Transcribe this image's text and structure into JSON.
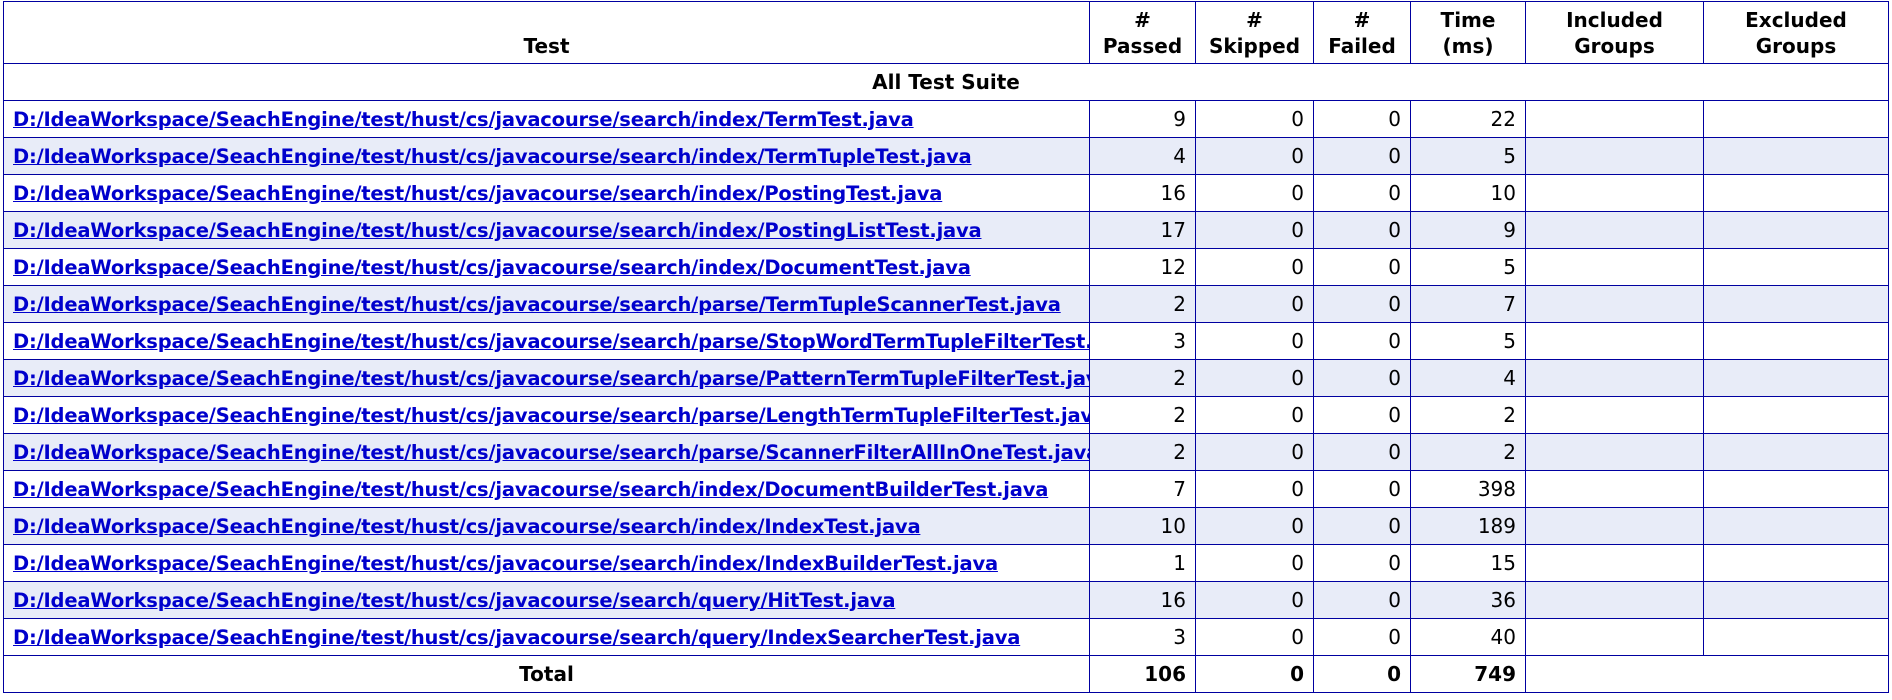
{
  "headers": {
    "test": "Test",
    "passed": "# Passed",
    "skipped": "# Skipped",
    "failed": "# Failed",
    "time": "Time (ms)",
    "included": "Included Groups",
    "excluded": "Excluded Groups"
  },
  "suite_title": "All Test Suite",
  "rows": [
    {
      "name": "D:/IdeaWorkspace/SeachEngine/test/hust/cs/javacourse/search/index/TermTest.java",
      "passed": "9",
      "skipped": "0",
      "failed": "0",
      "time": "22",
      "included": "",
      "excluded": ""
    },
    {
      "name": "D:/IdeaWorkspace/SeachEngine/test/hust/cs/javacourse/search/index/TermTupleTest.java",
      "passed": "4",
      "skipped": "0",
      "failed": "0",
      "time": "5",
      "included": "",
      "excluded": ""
    },
    {
      "name": "D:/IdeaWorkspace/SeachEngine/test/hust/cs/javacourse/search/index/PostingTest.java",
      "passed": "16",
      "skipped": "0",
      "failed": "0",
      "time": "10",
      "included": "",
      "excluded": ""
    },
    {
      "name": "D:/IdeaWorkspace/SeachEngine/test/hust/cs/javacourse/search/index/PostingListTest.java",
      "passed": "17",
      "skipped": "0",
      "failed": "0",
      "time": "9",
      "included": "",
      "excluded": ""
    },
    {
      "name": "D:/IdeaWorkspace/SeachEngine/test/hust/cs/javacourse/search/index/DocumentTest.java",
      "passed": "12",
      "skipped": "0",
      "failed": "0",
      "time": "5",
      "included": "",
      "excluded": ""
    },
    {
      "name": "D:/IdeaWorkspace/SeachEngine/test/hust/cs/javacourse/search/parse/TermTupleScannerTest.java",
      "passed": "2",
      "skipped": "0",
      "failed": "0",
      "time": "7",
      "included": "",
      "excluded": ""
    },
    {
      "name": "D:/IdeaWorkspace/SeachEngine/test/hust/cs/javacourse/search/parse/StopWordTermTupleFilterTest.java",
      "passed": "3",
      "skipped": "0",
      "failed": "0",
      "time": "5",
      "included": "",
      "excluded": ""
    },
    {
      "name": "D:/IdeaWorkspace/SeachEngine/test/hust/cs/javacourse/search/parse/PatternTermTupleFilterTest.java",
      "passed": "2",
      "skipped": "0",
      "failed": "0",
      "time": "4",
      "included": "",
      "excluded": ""
    },
    {
      "name": "D:/IdeaWorkspace/SeachEngine/test/hust/cs/javacourse/search/parse/LengthTermTupleFilterTest.java",
      "passed": "2",
      "skipped": "0",
      "failed": "0",
      "time": "2",
      "included": "",
      "excluded": ""
    },
    {
      "name": "D:/IdeaWorkspace/SeachEngine/test/hust/cs/javacourse/search/parse/ScannerFilterAllInOneTest.java",
      "passed": "2",
      "skipped": "0",
      "failed": "0",
      "time": "2",
      "included": "",
      "excluded": ""
    },
    {
      "name": "D:/IdeaWorkspace/SeachEngine/test/hust/cs/javacourse/search/index/DocumentBuilderTest.java",
      "passed": "7",
      "skipped": "0",
      "failed": "0",
      "time": "398",
      "included": "",
      "excluded": ""
    },
    {
      "name": "D:/IdeaWorkspace/SeachEngine/test/hust/cs/javacourse/search/index/IndexTest.java",
      "passed": "10",
      "skipped": "0",
      "failed": "0",
      "time": "189",
      "included": "",
      "excluded": ""
    },
    {
      "name": "D:/IdeaWorkspace/SeachEngine/test/hust/cs/javacourse/search/index/IndexBuilderTest.java",
      "passed": "1",
      "skipped": "0",
      "failed": "0",
      "time": "15",
      "included": "",
      "excluded": ""
    },
    {
      "name": "D:/IdeaWorkspace/SeachEngine/test/hust/cs/javacourse/search/query/HitTest.java",
      "passed": "16",
      "skipped": "0",
      "failed": "0",
      "time": "36",
      "included": "",
      "excluded": ""
    },
    {
      "name": "D:/IdeaWorkspace/SeachEngine/test/hust/cs/javacourse/search/query/IndexSearcherTest.java",
      "passed": "3",
      "skipped": "0",
      "failed": "0",
      "time": "40",
      "included": "",
      "excluded": ""
    }
  ],
  "total": {
    "label": "Total",
    "passed": "106",
    "skipped": "0",
    "failed": "0",
    "time": "749"
  },
  "colors": {
    "border": "#0000a0",
    "link": "#0000cc",
    "alt_row": "#e8ecf8"
  }
}
